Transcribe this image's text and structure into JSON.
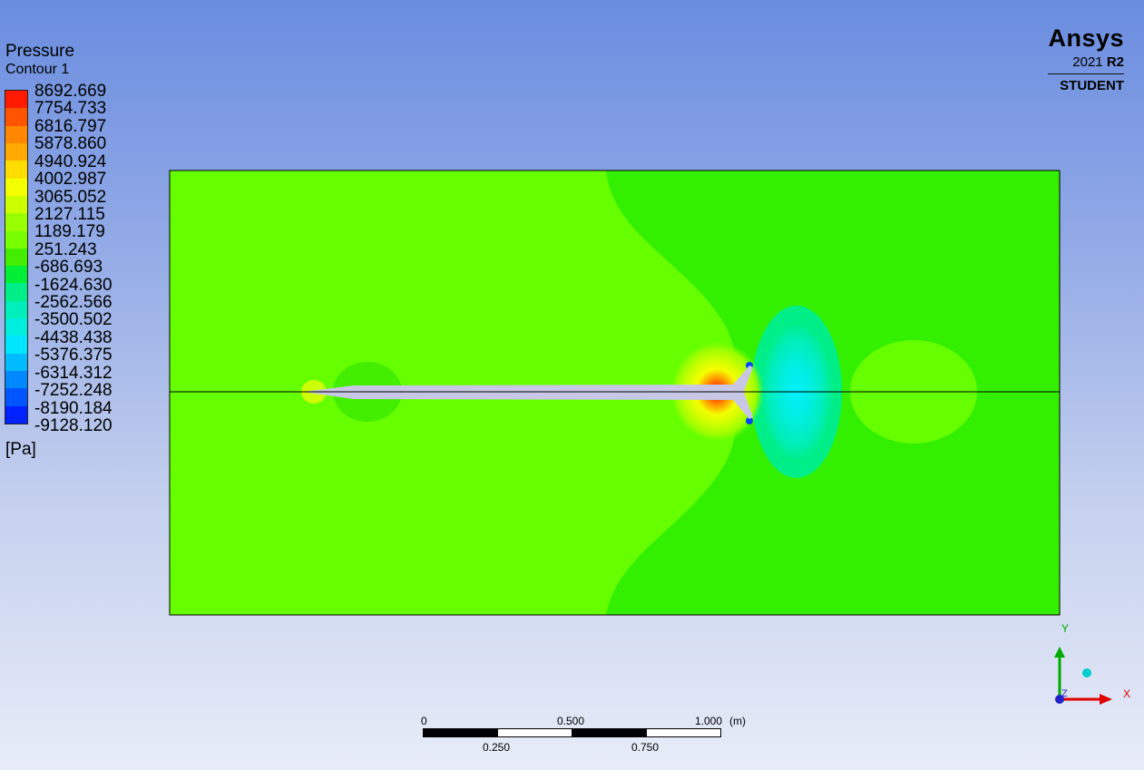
{
  "legend": {
    "title": "Pressure",
    "subtitle": "Contour 1",
    "unit": "[Pa]",
    "labels": [
      "8692.669",
      "7754.733",
      "6816.797",
      "5878.860",
      "4940.924",
      "4002.987",
      "3065.052",
      "2127.115",
      "1189.179",
      "251.243",
      "-686.693",
      "-1624.630",
      "-2562.566",
      "-3500.502",
      "-4438.438",
      "-5376.375",
      "-6314.312",
      "-7252.248",
      "-8190.184",
      "-9128.120"
    ],
    "band_colors": [
      "#ff1a00",
      "#ff5500",
      "#ff8800",
      "#ffaa00",
      "#ffdd00",
      "#f4ff00",
      "#ccff00",
      "#99ff00",
      "#77ff00",
      "#44ee00",
      "#00ee33",
      "#00ee88",
      "#00eebb",
      "#00eedd",
      "#00e6ff",
      "#00bbff",
      "#0088ff",
      "#0055ff",
      "#0022ff"
    ]
  },
  "logo": {
    "name": "Ansys",
    "version_year": "2021",
    "version_release": "R2",
    "edition": "STUDENT"
  },
  "scale": {
    "top_labels": [
      "0",
      "0.500",
      "1.000",
      "(m)"
    ],
    "bottom_labels": [
      "0.250",
      "0.750"
    ]
  },
  "axes": {
    "x_label": "X",
    "y_label": "Y",
    "z_label": "Z"
  },
  "colors": {
    "field_upstream": "#66ff00",
    "field_downstream": "#33f000",
    "body": "#c8c8e6",
    "low_pressure": "#00f0ff"
  }
}
